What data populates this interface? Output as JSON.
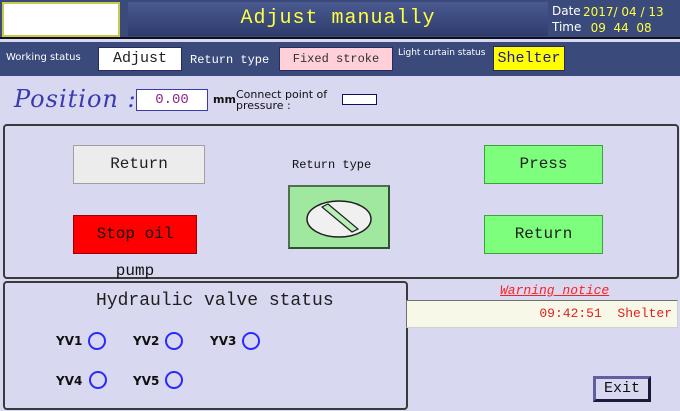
{
  "header": {
    "title": "Adjust manually",
    "date_label": "Date",
    "time_label": "Time",
    "date_value": "2017/ 04 / 13",
    "time_value": "  09  44  08"
  },
  "status": {
    "working_status_label": "Working status",
    "working_status_value": "Adjust",
    "return_type_label": "Return type",
    "return_type_value": "Fixed stroke",
    "light_curtain_label": "Light curtain status",
    "light_curtain_value": "Shelter"
  },
  "position": {
    "label": "Position :",
    "value": "0.00",
    "unit": "mm",
    "connect_point_label": "Connect point of pressure :"
  },
  "controls": {
    "return_left": "Return",
    "stop_oil_pump": "Stop oil pump",
    "return_type_label": "Return type",
    "press": "Press",
    "return_right": "Return"
  },
  "valves": {
    "title": "Hydraulic valve status",
    "items": [
      {
        "label": "YV1"
      },
      {
        "label": "YV2"
      },
      {
        "label": "YV3"
      },
      {
        "label": "YV4"
      },
      {
        "label": "YV5"
      }
    ]
  },
  "warning": {
    "title": "Warning notice",
    "message": "09:42:51  Shelter"
  },
  "exit_label": "Exit",
  "colors": {
    "header_bg": "#3a4a7a",
    "title_text": "#ffff40",
    "stop_button": "#ff0000",
    "green_button": "#7dff7d",
    "valve_indicator": "#2a2aff",
    "warning_text": "#ff2020"
  }
}
